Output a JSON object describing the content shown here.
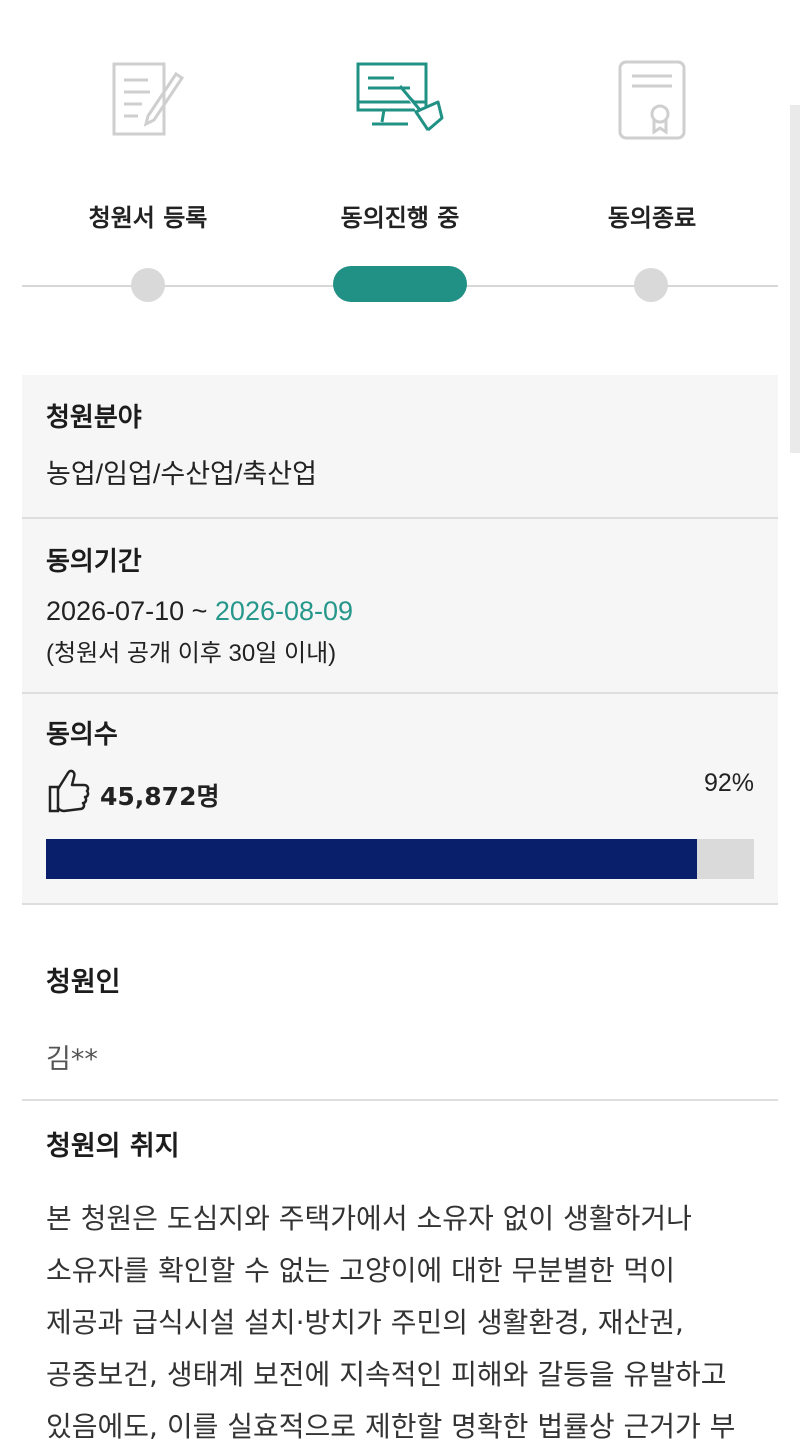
{
  "steps": [
    {
      "label": "청원서 등록",
      "icon": "document-pen-icon",
      "active": false
    },
    {
      "label": "동의진행 중",
      "icon": "monitor-click-icon",
      "active": true
    },
    {
      "label": "동의종료",
      "icon": "certificate-icon",
      "active": false
    }
  ],
  "colors": {
    "accent": "#219185",
    "bar": "#0a1f6b",
    "inactive": "#d9d9d9"
  },
  "info": {
    "field": {
      "title": "청원분야",
      "value": "농업/임업/수산업/축산업"
    },
    "period": {
      "title": "동의기간",
      "start": "2026-07-10",
      "separator": " ~ ",
      "end": "2026-08-09",
      "note": "(청원서 공개 이후 30일 이내)"
    },
    "agree": {
      "title": "동의수",
      "count": "45,872명",
      "percent_label": "92%",
      "percent": 92
    }
  },
  "petitioner": {
    "title": "청원인",
    "name": "김**"
  },
  "purpose": {
    "title": "청원의 취지",
    "body": "본 청원은 도심지와 주택가에서 소유자 없이 생활하거나 소유자를 확인할 수 없는 고양이에 대한 무분별한 먹이 제공과 급식시설 설치·방치가 주민의 생활환경, 재산권, 공중보건, 생태계 보전에 지속적인 피해와 갈등을 유발하고 있음에도, 이를 실효적으로 제한할 명확한 법률상 근거가 부"
  }
}
